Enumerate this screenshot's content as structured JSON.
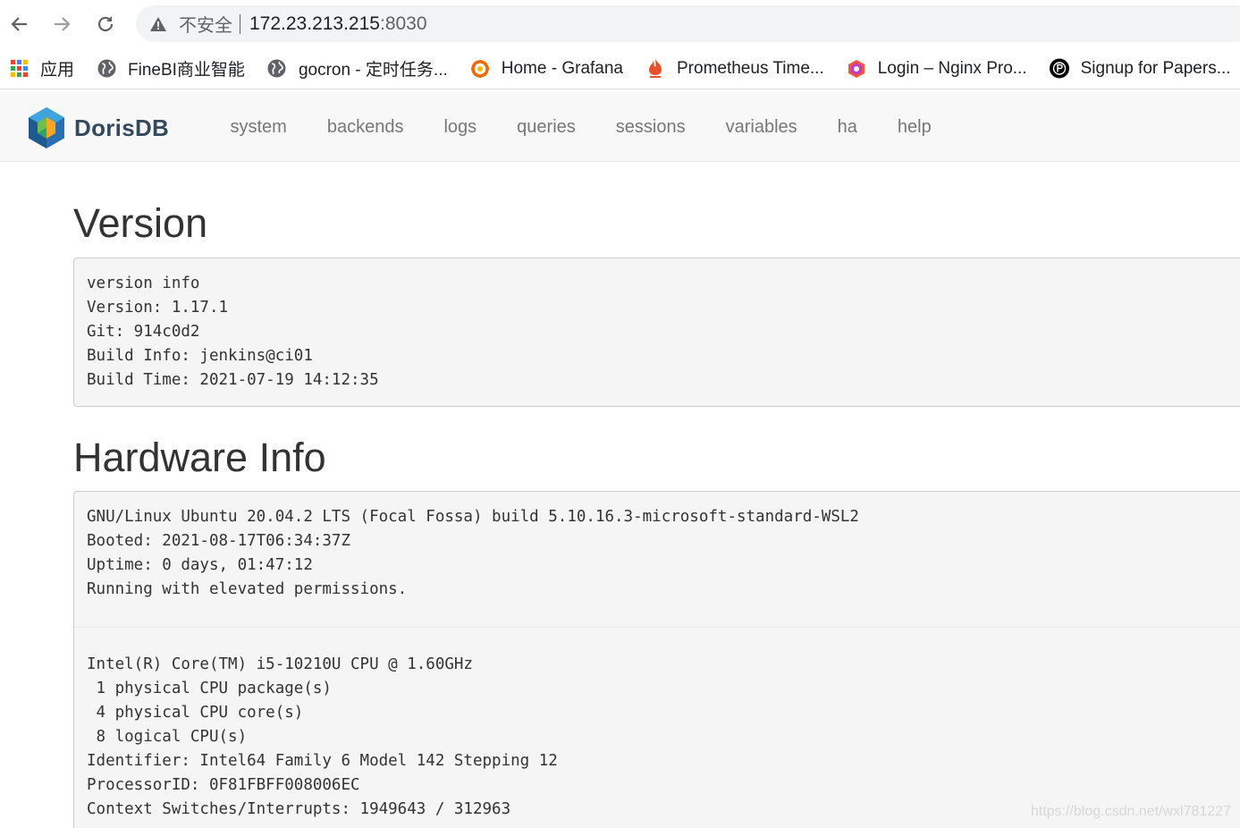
{
  "browser": {
    "security_label": "不安全",
    "url_host": "172.23.213.215",
    "url_port": ":8030",
    "bookmarks": [
      {
        "label": "应用",
        "icon": "apps-grid-icon"
      },
      {
        "label": "FineBI商业智能",
        "icon": "globe-icon"
      },
      {
        "label": "gocron - 定时任务...",
        "icon": "globe-icon"
      },
      {
        "label": "Home - Grafana",
        "icon": "grafana-icon"
      },
      {
        "label": "Prometheus Time...",
        "icon": "prometheus-icon"
      },
      {
        "label": "Login – Nginx Pro...",
        "icon": "nginx-proxy-icon"
      },
      {
        "label": "Signup for Papers...",
        "icon": "papers-icon"
      }
    ]
  },
  "app": {
    "brand": "DorisDB",
    "nav": [
      "system",
      "backends",
      "logs",
      "queries",
      "sessions",
      "variables",
      "ha",
      "help"
    ]
  },
  "version": {
    "heading": "Version",
    "lines": "version info\nVersion: 1.17.1\nGit: 914c0d2\nBuild Info: jenkins@ci01\nBuild Time: 2021-07-19 14:12:35"
  },
  "hardware": {
    "heading": "Hardware Info",
    "os_lines": "GNU/Linux Ubuntu 20.04.2 LTS (Focal Fossa) build 5.10.16.3-microsoft-standard-WSL2\nBooted: 2021-08-17T06:34:37Z\nUptime: 0 days, 01:47:12\nRunning with elevated permissions.",
    "cpu_lines": "Intel(R) Core(TM) i5-10210U CPU @ 1.60GHz\n 1 physical CPU package(s)\n 4 physical CPU core(s)\n 8 logical CPU(s)\nIdentifier: Intel64 Family 6 Model 142 Stepping 12\nProcessorID: 0F81FBFF008006EC\nContext Switches/Interrupts: 1949643 / 312963"
  },
  "watermark": "https://blog.csdn.net/wxl781227",
  "colors": {
    "nav_bg": "#f8f8f8",
    "nav_link": "#777777",
    "brand_text": "#34495e",
    "well_bg": "#f5f5f5",
    "well_border": "#cccccc"
  }
}
